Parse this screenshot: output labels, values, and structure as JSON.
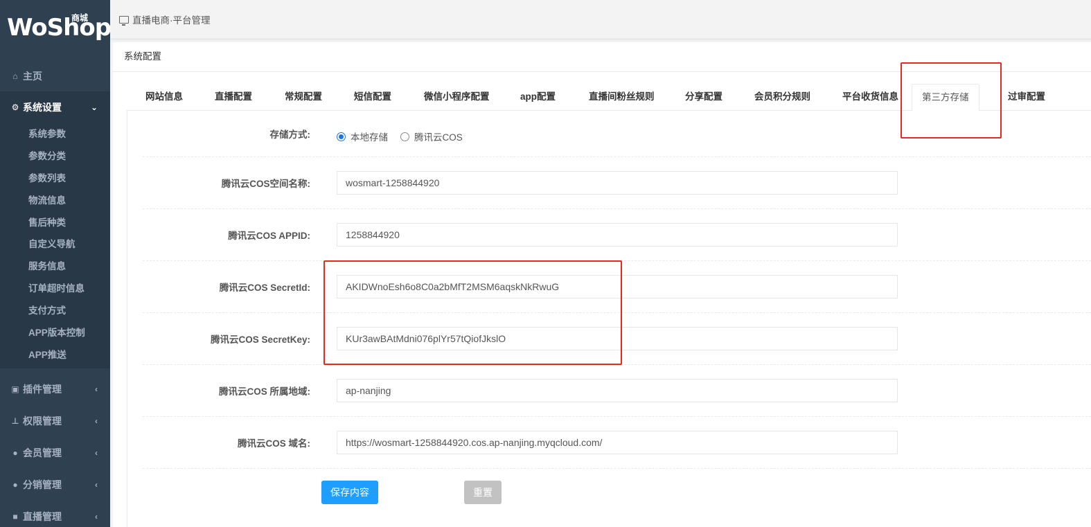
{
  "brand": {
    "logo_text": "WoShop",
    "logo_sub": "商城"
  },
  "sidebar": {
    "home": "主页",
    "system": "系统设置",
    "sub_items": [
      "系统参数",
      "参数分类",
      "参数列表",
      "物流信息",
      "售后种类",
      "自定义导航",
      "服务信息",
      "订单超时信息",
      "支付方式",
      "APP版本控制",
      "APP推送"
    ],
    "groups": [
      {
        "label": "插件管理",
        "icon": "plugin-icon"
      },
      {
        "label": "权限管理",
        "icon": "sitemap-icon"
      },
      {
        "label": "会员管理",
        "icon": "users-icon"
      },
      {
        "label": "分销管理",
        "icon": "users-icon"
      },
      {
        "label": "直播管理",
        "icon": "video-icon"
      }
    ]
  },
  "breadcrumb": "直播电商·平台管理",
  "panel_title": "系统配置",
  "tabs": [
    "网站信息",
    "直播配置",
    "常规配置",
    "短信配置",
    "微信小程序配置",
    "app配置",
    "直播间粉丝规则",
    "分享配置",
    "会员积分规则",
    "平台收货信息",
    "第三方存储",
    "过审配置"
  ],
  "active_tab": "第三方存储",
  "form": {
    "storage_label": "存储方式:",
    "storage_options": [
      "本地存储",
      "腾讯云COS"
    ],
    "storage_selected": "本地存储",
    "fields": [
      {
        "label": "腾讯云COS空间名称:",
        "value": "wosmart-1258844920"
      },
      {
        "label": "腾讯云COS APPID:",
        "value": "1258844920"
      },
      {
        "label": "腾讯云COS SecretId:",
        "value": "AKIDWnoEsh6o8C0a2bMfT2MSM6aqskNkRwuG"
      },
      {
        "label": "腾讯云COS SecretKey:",
        "value": "KUr3awBAtMdni076plYr57tQiofJkslO"
      },
      {
        "label": "腾讯云COS 所属地域:",
        "value": "ap-nanjing"
      },
      {
        "label": "腾讯云COS 域名:",
        "value": "https://wosmart-1258844920.cos.ap-nanjing.myqcloud.com/"
      }
    ],
    "save_label": "保存内容",
    "reset_label": "重置"
  },
  "colors": {
    "sidebar_bg": "#2f4050",
    "primary": "#1e9fff",
    "highlight": "#e8281c"
  }
}
